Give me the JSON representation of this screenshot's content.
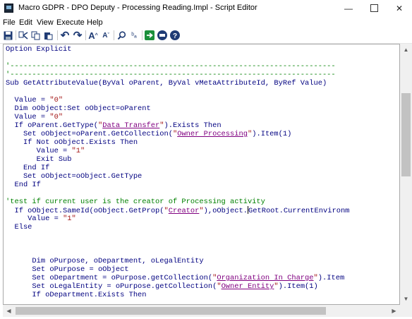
{
  "window": {
    "title": "Macro GDPR - DPO Deputy - Processing Reading.Impl - Script Editor",
    "minimize_glyph": "—",
    "close_glyph": "✕"
  },
  "menu": [
    "File",
    "Edit",
    "View",
    "Execute",
    "Help"
  ],
  "toolbar": {
    "icons": [
      "save-icon",
      "cut-icon",
      "copy-icon",
      "paste-icon",
      "undo-icon",
      "redo-icon",
      "font-increase-icon",
      "font-decrease-icon",
      "search-icon",
      "replace-icon",
      "run-icon",
      "stop-icon",
      "help-icon"
    ],
    "glyphs": {
      "save": "💾",
      "undo": "↶",
      "redo": "↷",
      "font_up": "A",
      "font_down": "A",
      "search": "⚲",
      "replace": "ᵇₐ",
      "run": "➔",
      "stop": "STOP",
      "help": "?"
    }
  },
  "code_lines": [
    [
      {
        "t": "Option Explicit",
        "c": "kw"
      }
    ],
    [
      {
        "t": "",
        "c": "kw"
      }
    ],
    [
      {
        "t": "'--------------------------------------------------------------------------",
        "c": "cmt"
      }
    ],
    [
      {
        "t": "'--------------------------------------------------------------------------",
        "c": "cmt"
      }
    ],
    [
      {
        "t": "Sub GetAttributeValue(ByVal oParent, ByVal vMetaAttributeId, ByRef Value)",
        "c": "kw"
      }
    ],
    [
      {
        "t": "",
        "c": "kw"
      }
    ],
    [
      {
        "t": "  Value = ",
        "c": "kw"
      },
      {
        "t": "\"0\"",
        "c": "str"
      }
    ],
    [
      {
        "t": "  Dim oObject:Set oObject=oParent",
        "c": "kw"
      }
    ],
    [
      {
        "t": "  Value = ",
        "c": "kw"
      },
      {
        "t": "\"0\"",
        "c": "str"
      }
    ],
    [
      {
        "t": "  If oParent.GetType(",
        "c": "kw"
      },
      {
        "t": "\"",
        "c": "str"
      },
      {
        "t": "Data Transfer",
        "c": "lnk"
      },
      {
        "t": "\"",
        "c": "str"
      },
      {
        "t": ").Exists Then",
        "c": "kw"
      }
    ],
    [
      {
        "t": "    Set oObject=oParent.GetCollection(",
        "c": "kw"
      },
      {
        "t": "\"",
        "c": "str"
      },
      {
        "t": "Owner Processing",
        "c": "lnk"
      },
      {
        "t": "\"",
        "c": "str"
      },
      {
        "t": ").Item(1)",
        "c": "kw"
      }
    ],
    [
      {
        "t": "    If Not oObject.Exists Then",
        "c": "kw"
      }
    ],
    [
      {
        "t": "       Value = ",
        "c": "kw"
      },
      {
        "t": "\"1\"",
        "c": "str"
      }
    ],
    [
      {
        "t": "       Exit Sub",
        "c": "kw"
      }
    ],
    [
      {
        "t": "    End If",
        "c": "kw"
      }
    ],
    [
      {
        "t": "    Set oObject=oObject.GetType",
        "c": "kw"
      }
    ],
    [
      {
        "t": "  End If",
        "c": "kw"
      }
    ],
    [
      {
        "t": "",
        "c": "kw"
      }
    ],
    [
      {
        "t": "'test if current user is the creator of Processing activity",
        "c": "cmt"
      }
    ],
    [
      {
        "t": "  If oObject.SameId(oObject.GetProp(",
        "c": "kw"
      },
      {
        "t": "\"",
        "c": "str"
      },
      {
        "t": "Creator",
        "c": "lnk"
      },
      {
        "t": "\"",
        "c": "str"
      },
      {
        "t": "),oObject.",
        "c": "kw"
      },
      {
        "t": "|",
        "c": "caret"
      },
      {
        "t": "GetRoot.CurrentEnvironm",
        "c": "kw"
      }
    ],
    [
      {
        "t": "     Value = ",
        "c": "kw"
      },
      {
        "t": "\"1\"",
        "c": "str"
      }
    ],
    [
      {
        "t": "  Else",
        "c": "kw"
      }
    ],
    [
      {
        "t": "",
        "c": "kw"
      }
    ],
    [
      {
        "t": "",
        "c": "kw"
      }
    ],
    [
      {
        "t": "",
        "c": "kw"
      }
    ],
    [
      {
        "t": "      Dim oPurpose, oDepartment, oLegalEntity",
        "c": "kw"
      }
    ],
    [
      {
        "t": "      Set oPurpose = oObject",
        "c": "kw"
      }
    ],
    [
      {
        "t": "      Set oDepartment = oPurpose.getCollection(",
        "c": "kw"
      },
      {
        "t": "\"",
        "c": "str"
      },
      {
        "t": "Organization In Charge",
        "c": "lnk"
      },
      {
        "t": "\"",
        "c": "str"
      },
      {
        "t": ").Item",
        "c": "kw"
      }
    ],
    [
      {
        "t": "      Set oLegalEntity = oPurpose.getCollection(",
        "c": "kw"
      },
      {
        "t": "\"",
        "c": "str"
      },
      {
        "t": "Owner Entity",
        "c": "lnk"
      },
      {
        "t": "\"",
        "c": "str"
      },
      {
        "t": ").Item(1)",
        "c": "kw"
      }
    ],
    [
      {
        "t": "      If oDepartment.Exists Then",
        "c": "kw"
      }
    ]
  ]
}
